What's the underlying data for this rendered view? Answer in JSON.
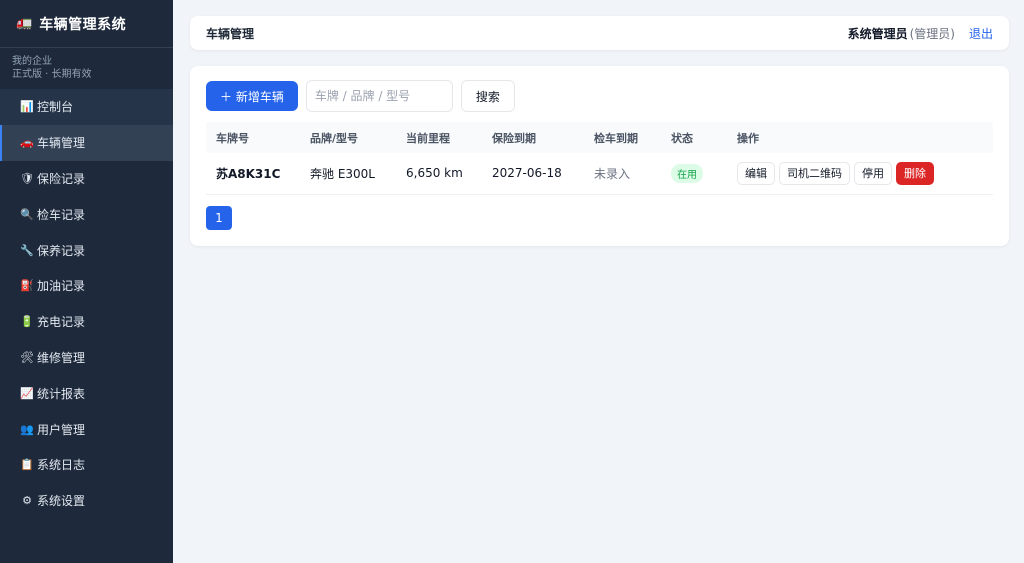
{
  "app": {
    "logo_icon": "truck-icon",
    "title": "车辆管理系统"
  },
  "org": {
    "name": "我的企业",
    "plan": "正式版 · 长期有效"
  },
  "sidebar": {
    "items": [
      {
        "icon": "📊",
        "icon_name": "chart-icon",
        "label": "控制台"
      },
      {
        "icon": "🚗",
        "icon_name": "car-icon",
        "label": "车辆管理"
      },
      {
        "icon": "🛡",
        "icon_name": "shield-icon",
        "label": "保险记录"
      },
      {
        "icon": "🔍",
        "icon_name": "magnifier-icon",
        "label": "检车记录"
      },
      {
        "icon": "🔧",
        "icon_name": "wrench-icon",
        "label": "保养记录"
      },
      {
        "icon": "⛽",
        "icon_name": "fuel-icon",
        "label": "加油记录"
      },
      {
        "icon": "🔋",
        "icon_name": "battery-icon",
        "label": "充电记录"
      },
      {
        "icon": "🛠",
        "icon_name": "tools-icon",
        "label": "维修管理"
      },
      {
        "icon": "📈",
        "icon_name": "trend-chart-icon",
        "label": "统计报表"
      },
      {
        "icon": "👥",
        "icon_name": "users-icon",
        "label": "用户管理"
      },
      {
        "icon": "📋",
        "icon_name": "clipboard-icon",
        "label": "系统日志"
      },
      {
        "icon": "⚙",
        "icon_name": "gear-icon",
        "label": "系统设置"
      }
    ]
  },
  "header": {
    "page_title": "车辆管理",
    "user": "系统管理员",
    "role": "(管理员)",
    "logout": "退出"
  },
  "toolbar": {
    "add_label": "＋ 新增车辆",
    "search_placeholder": "车牌 / 品牌 / 型号",
    "search_value": "",
    "search_button": "搜索"
  },
  "table": {
    "columns": [
      "车牌号",
      "品牌/型号",
      "当前里程",
      "保险到期",
      "检车到期",
      "状态",
      "操作"
    ],
    "rows": [
      {
        "plate": "苏A8K31C",
        "model": "奔驰 E300L",
        "mileage": "6,650 km",
        "insurance_due": "2027-06-18",
        "inspection_due": "未录入",
        "status": "在用",
        "actions": {
          "edit": "编辑",
          "qr": "司机二维码",
          "disable": "停用",
          "delete": "删除"
        }
      }
    ]
  },
  "pagination": {
    "current": "1"
  },
  "colors": {
    "sidebar_bg": "#1e293b",
    "accent": "#2563eb",
    "danger": "#dc2626",
    "status_ok": "#16a34a"
  }
}
